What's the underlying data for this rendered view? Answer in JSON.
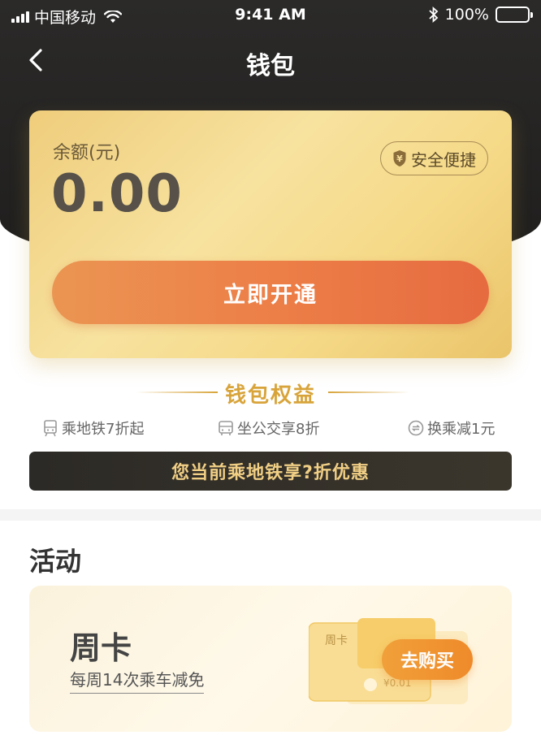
{
  "status_bar": {
    "carrier": "中国移动",
    "time": "9:41 AM",
    "battery": "100%",
    "battery_level": 1.0,
    "icons": [
      "signal-icon",
      "wifi-icon",
      "bluetooth-icon",
      "battery-icon"
    ]
  },
  "nav": {
    "title": "钱包",
    "back_icon": "chevron-left-icon"
  },
  "wallet": {
    "balance_label": "余额(元)",
    "balance": "0.00",
    "secure_badge": "安全便捷",
    "secure_icon": "yuan-shield-icon",
    "open_button": "立即开通"
  },
  "benefits": {
    "title": "钱包权益",
    "items": [
      {
        "label": "乘地铁7折起",
        "icon": "metro-icon"
      },
      {
        "label": "坐公交享8折",
        "icon": "bus-icon"
      },
      {
        "label": "换乘减1元",
        "icon": "transfer-icon"
      }
    ],
    "promo": "您当前乘地铁享?折优惠"
  },
  "activity": {
    "title": "活动",
    "card": {
      "title": "周卡",
      "description": "每周14次乘车减免",
      "button": "去购买",
      "art_label": "周卡",
      "art_price": "¥0.01"
    }
  },
  "colors": {
    "header_bg": "#232221",
    "card_gold": "#f3d78f",
    "button_orange": "#ec7d47",
    "benefit_gold": "#d8a43a",
    "promo_text": "#f1cf85",
    "buy_orange": "#ef8a2a"
  }
}
